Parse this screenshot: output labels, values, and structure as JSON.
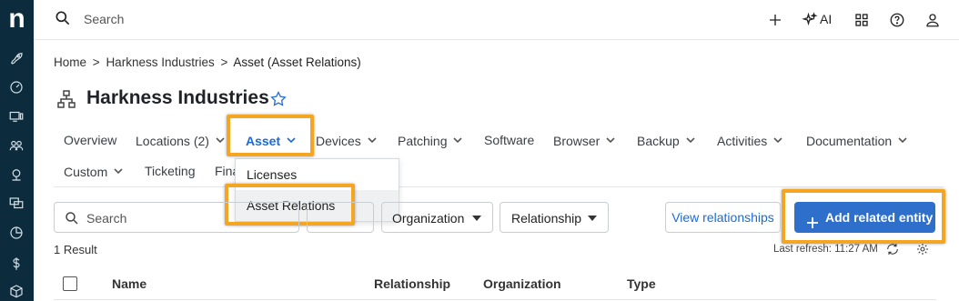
{
  "rail": {
    "logo": "n",
    "icons": [
      "rocket-icon",
      "gauge-icon",
      "devices-icon",
      "users-icon",
      "headset-icon",
      "monitors-icon",
      "chart-pie-icon",
      "dollar-icon",
      "box-icon"
    ]
  },
  "topbar": {
    "search_placeholder": "Search",
    "ai_label": "AI"
  },
  "breadcrumb": {
    "items": [
      "Home",
      "Harkness Industries"
    ],
    "current": "Asset (Asset Relations)",
    "separator": ">"
  },
  "page": {
    "title": "Harkness Industries"
  },
  "tabs": [
    {
      "label": "Overview"
    },
    {
      "label": "Locations (2)"
    },
    {
      "label": "Asset"
    },
    {
      "label": "Devices"
    },
    {
      "label": "Patching"
    },
    {
      "label": "Software"
    },
    {
      "label": "Browser"
    },
    {
      "label": "Backup"
    },
    {
      "label": "Activities"
    },
    {
      "label": "Documentation"
    },
    {
      "label": "Custom"
    },
    {
      "label": "Ticketing"
    },
    {
      "label": "Fina"
    }
  ],
  "dropdown": {
    "items": [
      "Licenses",
      "Asset Relations"
    ],
    "selected": "Asset Relations"
  },
  "filters": {
    "search_placeholder": "Search",
    "organization_label": "Organization",
    "relationship_label": "Relationship",
    "view_button": "View relationships",
    "add_button": "Add related entity"
  },
  "results": {
    "count_text": "1 Result",
    "last_refresh": "Last refresh: 11:27 AM"
  },
  "table": {
    "columns": [
      "Name",
      "Relationship",
      "Organization",
      "Type"
    ]
  },
  "colors": {
    "rail_bg": "#0c2b3d",
    "accent": "#1d6bd1",
    "primary_button": "#2d6fcb",
    "highlight": "#f4a623"
  }
}
